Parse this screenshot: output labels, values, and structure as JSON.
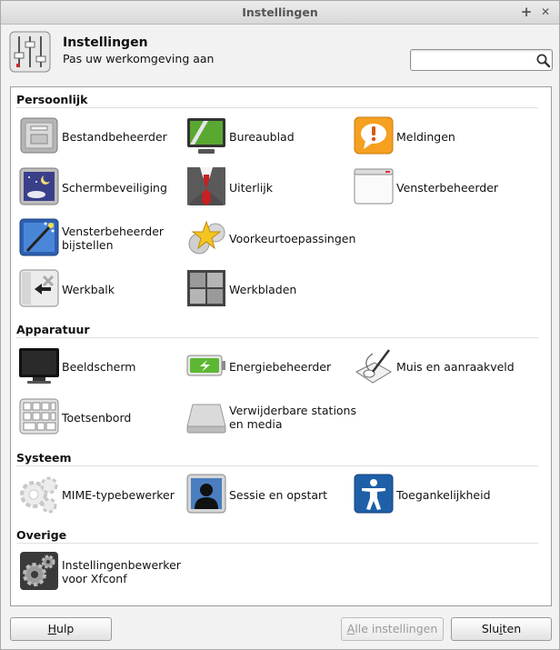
{
  "window": {
    "title": "Instellingen",
    "controls": [
      "+",
      "✕"
    ]
  },
  "header": {
    "title": "Instellingen",
    "subtitle": "Pas uw werkomgeving aan",
    "search_value": "",
    "search_placeholder": ""
  },
  "sections": {
    "personal": {
      "title": "Persoonlijk",
      "items": [
        {
          "label": "Bestandbeheerder",
          "icon": "file-manager-icon"
        },
        {
          "label": "Bureaublad",
          "icon": "desktop-icon"
        },
        {
          "label": "Meldingen",
          "icon": "notifications-icon"
        },
        {
          "label": "Schermbeveiliging",
          "icon": "screensaver-icon"
        },
        {
          "label": "Uiterlijk",
          "icon": "appearance-icon"
        },
        {
          "label": "Vensterbeheerder",
          "icon": "window-manager-icon"
        },
        {
          "label": "Vensterbeheerder bijstellen",
          "icon": "window-manager-tweaks-icon"
        },
        {
          "label": "Voorkeurtoepassingen",
          "icon": "preferred-applications-icon"
        },
        {
          "label": "Werkbalk",
          "icon": "panel-icon"
        },
        {
          "label": "Werkbladen",
          "icon": "workspaces-icon"
        }
      ]
    },
    "hardware": {
      "title": "Apparatuur",
      "items": [
        {
          "label": "Beeldscherm",
          "icon": "display-icon"
        },
        {
          "label": "Energiebeheerder",
          "icon": "power-manager-icon"
        },
        {
          "label": "Muis en aanraakveld",
          "icon": "mouse-icon"
        },
        {
          "label": "Toetsenbord",
          "icon": "keyboard-icon"
        },
        {
          "label": "Verwijderbare stations en media",
          "icon": "removable-drives-icon"
        }
      ]
    },
    "system": {
      "title": "Systeem",
      "items": [
        {
          "label": "MIME-typebewerker",
          "icon": "mime-editor-icon"
        },
        {
          "label": "Sessie en opstart",
          "icon": "session-icon"
        },
        {
          "label": "Toegankelijkheid",
          "icon": "accessibility-icon"
        }
      ]
    },
    "other": {
      "title": "Overige",
      "items": [
        {
          "label": "Instellingenbewerker voor Xfconf",
          "icon": "settings-editor-icon"
        }
      ]
    }
  },
  "footer": {
    "help": {
      "mnemonic": "H",
      "rest": "ulp"
    },
    "all_settings": {
      "mnemonic": "A",
      "rest": "lle instellingen"
    },
    "close": {
      "pre": "Slu",
      "mnemonic": "i",
      "rest": "ten"
    }
  },
  "colors": {
    "window_bg": "#f2f2f2",
    "panel_bg": "#ffffff",
    "notification_orange": "#f5a020",
    "accessibility_blue": "#1e5fa8",
    "power_green": "#5cb832"
  }
}
